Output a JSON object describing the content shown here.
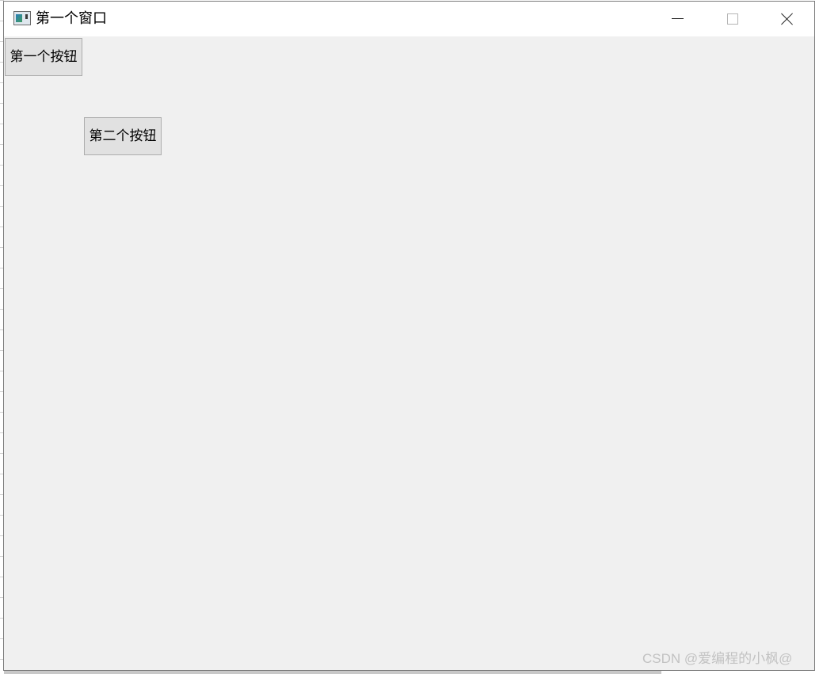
{
  "window": {
    "title": "第一个窗口",
    "icon": "app-window-icon"
  },
  "caption_buttons": {
    "minimize_icon": "minimize-icon",
    "maximize_icon": "maximize-icon",
    "close_icon": "close-icon"
  },
  "buttons": {
    "first_label": "第一个按钮",
    "second_label": "第二个按钮"
  },
  "watermark": {
    "text": "CSDN @爱编程的小枫@"
  },
  "colors": {
    "client_bg": "#f0f0f0",
    "titlebar_bg": "#ffffff",
    "button_bg": "#e1e1e1",
    "button_border": "#adadad"
  }
}
